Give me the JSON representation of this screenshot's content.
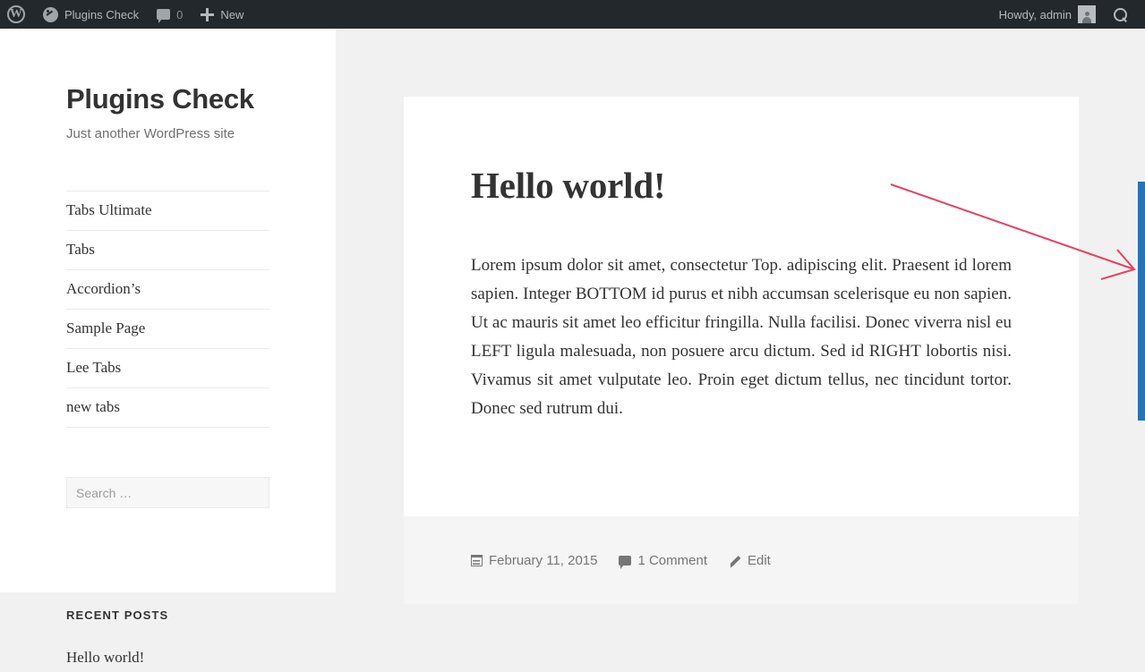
{
  "adminbar": {
    "wp_logo": "W",
    "site_name": "Plugins Check",
    "comment_count": "0",
    "new_label": "New",
    "howdy": "Howdy, admin"
  },
  "sidebar": {
    "site_title": "Plugins Check",
    "tagline": "Just another WordPress site",
    "nav_items": [
      {
        "label": "Tabs Ultimate"
      },
      {
        "label": "Tabs"
      },
      {
        "label": "Accordion’s"
      },
      {
        "label": "Sample Page"
      },
      {
        "label": "Lee Tabs"
      },
      {
        "label": "new tabs"
      }
    ],
    "search_placeholder": "Search …",
    "search_value": ""
  },
  "widgets": {
    "recent_posts_heading": "RECENT POSTS",
    "recent_posts": [
      {
        "label": "Hello world!"
      }
    ]
  },
  "post": {
    "title": "Hello world!",
    "body": "Lorem ipsum dolor sit amet, consectetur Top. adipiscing elit. Praesent id lorem sapien. Integer BOTTOM id purus et nibh accumsan scelerisque eu non sapien. Ut ac mauris sit amet leo efficitur fringilla. Nulla facilisi. Donec viverra nisl eu LEFT ligula malesuada, non posuere arcu dictum. Sed id RIGHT lobortis nisi. Vivamus sit amet vulputate leo. Proin eget dictum tellus, nec tincidunt tortor. Donec sed rutrum dui.",
    "date": "February 11, 2015",
    "comments": "1 Comment",
    "edit": "Edit"
  },
  "colors": {
    "adminbar_bg": "#23282d",
    "sidebar_bg": "#ffffff",
    "page_bg": "#f1f1f1",
    "card_bg": "#ffffff",
    "card_footer_bg": "#f5f5f5",
    "meta_text": "#767676",
    "blue_bar": "#2573b8",
    "annotation_red": "#e8425f"
  }
}
